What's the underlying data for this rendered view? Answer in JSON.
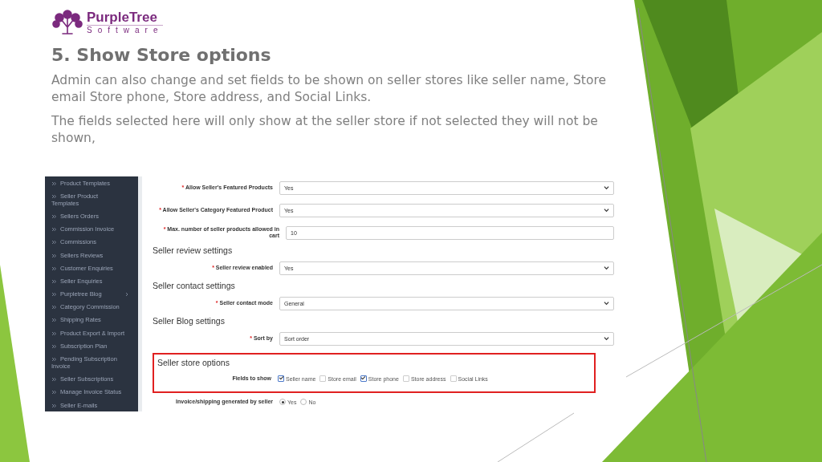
{
  "logo": {
    "name": "PurpleTree",
    "subtitle": "Software"
  },
  "title": "5. Show Store options",
  "paragraphs": [
    "Admin can also change and set fields to be shown on seller stores like seller name, Store email Store phone, Store address, and Social Links.",
    "The fields selected here will only show at the seller store if not selected they will not be shown,"
  ],
  "screenshot": {
    "sidebar": {
      "items": [
        {
          "label": "Product Templates",
          "submenu": false
        },
        {
          "label": "Seller Product Templates",
          "submenu": false
        },
        {
          "label": "Sellers Orders",
          "submenu": false
        },
        {
          "label": "Commission Invoice",
          "submenu": false
        },
        {
          "label": "Commissions",
          "submenu": false
        },
        {
          "label": "Sellers Reviews",
          "submenu": false
        },
        {
          "label": "Customer Enquiries",
          "submenu": false
        },
        {
          "label": "Seller Enquiries",
          "submenu": false
        },
        {
          "label": "Purpletree Blog",
          "submenu": true
        },
        {
          "label": "Category Commission",
          "submenu": false
        },
        {
          "label": "Shipping Rates",
          "submenu": false
        },
        {
          "label": "Product Export & Import",
          "submenu": false
        },
        {
          "label": "Subscription Plan",
          "submenu": false
        },
        {
          "label": "Pending Subscription Invoice",
          "submenu": false
        },
        {
          "label": "Seller Subscriptions",
          "submenu": false
        },
        {
          "label": "Manage Invoice Status",
          "submenu": false
        },
        {
          "label": "Seller E-mails",
          "submenu": false
        }
      ]
    },
    "form": {
      "groups": [
        {
          "highlighted": false,
          "rows": [
            {
              "kind": "select",
              "required_mark": "*",
              "label": "Allow Seller's Featured Products",
              "value": "Yes"
            },
            {
              "kind": "select",
              "required_mark": "*",
              "label": "Allow Seller's Category Featured Product",
              "value": "Yes"
            },
            {
              "kind": "text",
              "required_mark": "*",
              "label": "Max. number of seller products allowed in cart",
              "value": "10"
            },
            {
              "kind": "heading",
              "label": "Seller review settings"
            },
            {
              "kind": "select",
              "required_mark": "*",
              "label": "Seller review enabled",
              "value": "Yes"
            },
            {
              "kind": "heading",
              "label": "Seller contact settings"
            },
            {
              "kind": "select",
              "required_mark": "*",
              "label": "Seller contact mode",
              "value": "General"
            },
            {
              "kind": "heading",
              "label": "Seller Blog settings"
            },
            {
              "kind": "select",
              "required_mark": "*",
              "label": "Sort by",
              "value": "Sort order"
            }
          ]
        },
        {
          "highlighted": true,
          "rows": [
            {
              "kind": "heading",
              "label": "Seller store options"
            },
            {
              "kind": "checkboxes",
              "label": "Fields to show",
              "options": [
                {
                  "label": "Seller name",
                  "checked": true
                },
                {
                  "label": "Store email",
                  "checked": false
                },
                {
                  "label": "Store phone",
                  "checked": true
                },
                {
                  "label": "Store address",
                  "checked": false
                },
                {
                  "label": "Social Links",
                  "checked": false
                }
              ]
            }
          ]
        },
        {
          "highlighted": false,
          "rows": [
            {
              "kind": "radios",
              "label": "Invoice/shipping generated by seller",
              "options": [
                {
                  "label": "Yes",
                  "selected": true
                },
                {
                  "label": "No",
                  "selected": false
                }
              ]
            }
          ]
        }
      ]
    }
  }
}
